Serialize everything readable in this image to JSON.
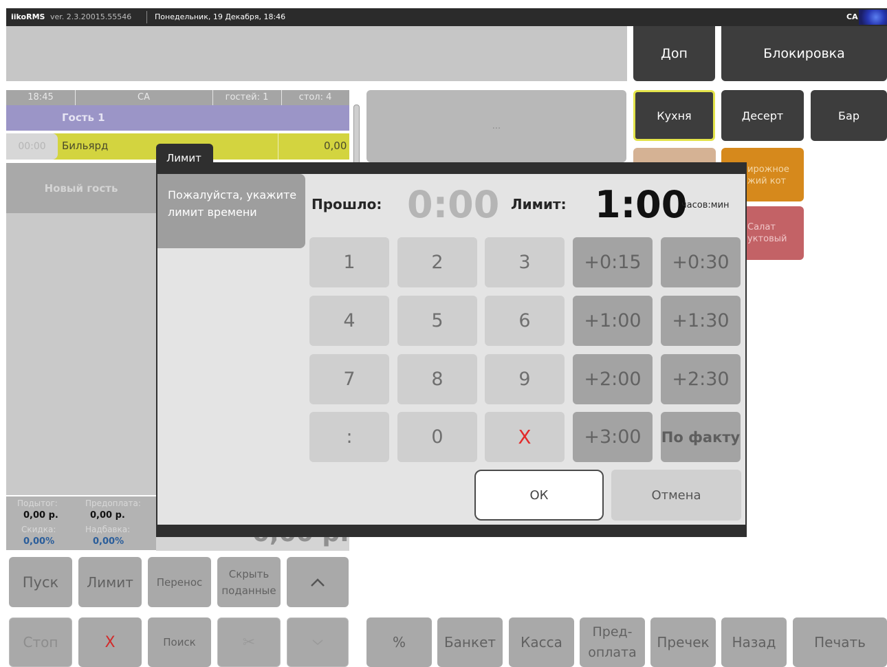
{
  "topbar": {
    "app": "iikoRMS",
    "version": "ver. 2.3.20015.55546",
    "date": "Понедельник, 19 Декабря, 18:46",
    "user": "CA"
  },
  "header": {
    "dop": "Доп",
    "block": "Блокировка"
  },
  "categories": {
    "kitchen": "Кухня",
    "dessert": "Десерт",
    "bar": "Бар",
    "orange": "ирожное\nжий кот",
    "red": "Салат\nуктовый"
  },
  "order": {
    "time": "18:45",
    "waiter": "CA",
    "guests": "гостей: 1",
    "table": "стол: 4",
    "guest": "Гость 1",
    "item_time": "00:00",
    "item_name": "Бильярд",
    "item_price": "0,00",
    "new_guest": "Новый гость",
    "center_dots": "..."
  },
  "totals": {
    "subtotal_label": "Подытог:",
    "subtotal": "0,00 р.",
    "prepay_label": "Предоплата:",
    "prepay": "0,00 р.",
    "discount_label": "Скидка:",
    "discount": "0,00%",
    "markup_label": "Надбавка:",
    "markup": "0,00%",
    "big_total": "0,00 р."
  },
  "bottom": {
    "start": "Пуск",
    "limit": "Лимит",
    "transfer": "Перенос",
    "hide_served": "Скрыть\nподанные",
    "up": "^",
    "stop": "Стоп",
    "delete": "X",
    "search": "Поиск",
    "down": "v",
    "percent": "%",
    "banquet": "Банкет",
    "cash": "Касса",
    "prepay": "Пред-\nоплата",
    "precheck": "Пречек",
    "back": "Назад",
    "print": "Печать"
  },
  "dialog": {
    "title": "Лимит",
    "prompt": "Пожалуйста, укажите лимит времени",
    "elapsed_label": "Прошло:",
    "elapsed_value": "0:00",
    "limit_label": "Лимит:",
    "limit_value": "1:00",
    "units": "часов:мин",
    "keys": {
      "k1": "1",
      "k2": "2",
      "k3": "3",
      "p015": "+0:15",
      "p030": "+0:30",
      "k4": "4",
      "k5": "5",
      "k6": "6",
      "p100": "+1:00",
      "p130": "+1:30",
      "k7": "7",
      "k8": "8",
      "k9": "9",
      "p200": "+2:00",
      "p230": "+2:30",
      "colon": ":",
      "k0": "0",
      "clear": "X",
      "p300": "+3:00",
      "fact": "По факту"
    },
    "ok": "ОК",
    "cancel": "Отмена"
  }
}
